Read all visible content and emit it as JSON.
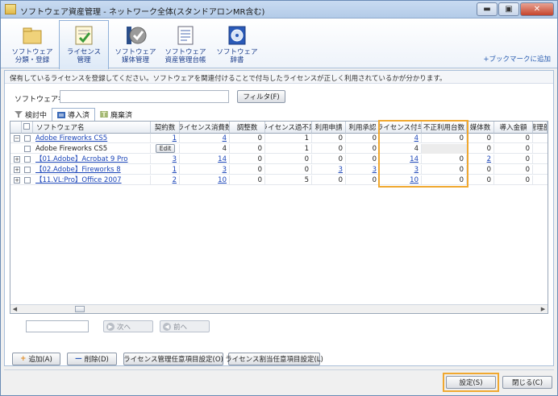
{
  "window": {
    "title": "ソフトウェア資産管理 - ネットワーク全体(スタンドアロンMR含む)",
    "min_glyph": "▬",
    "max_glyph": "▣",
    "close_glyph": "✕"
  },
  "ribbon": {
    "items": [
      {
        "label1": "ソフトウェア",
        "label2": "分類・登録",
        "icon": "folder-icon"
      },
      {
        "label1": "ライセンス",
        "label2": "管理",
        "icon": "license-check-icon"
      },
      {
        "label1": "ソフトウェア",
        "label2": "媒体管理",
        "icon": "media-disc-icon"
      },
      {
        "label1": "ソフトウェア",
        "label2": "資産管理台帳",
        "icon": "ledger-icon"
      },
      {
        "label1": "ソフトウェア",
        "label2": "辞書",
        "icon": "dictionary-cd-icon"
      }
    ],
    "bookmark": "+ブックマークに追加"
  },
  "info_text": "保有しているライセンスを登録してください。ソフトウェアを関連付けることで付与したライセンスが正しく利用されているかが分かります。",
  "filter": {
    "label": "ソフトウェア名",
    "value": "",
    "button": "フィルタ(F)"
  },
  "tabs": [
    {
      "label": "検討中",
      "icon": "funnel-icon",
      "active": false
    },
    {
      "label": "導入済",
      "icon": "list-icon",
      "active": true
    },
    {
      "label": "廃棄済",
      "icon": "trash-icon",
      "active": false
    }
  ],
  "grid": {
    "columns": [
      "ソフトウェア名",
      "契約数",
      "ライセンス消費数",
      "調整数",
      "ライセンス過不足",
      "利用申請",
      "利用承認",
      "ライセンス付与",
      "不正利用台数",
      "媒体数",
      "導入金額",
      "管理部"
    ],
    "edit_label": "Edit",
    "rows": [
      {
        "expander": "−",
        "name": "Adobe Fireworks CS5",
        "link": true,
        "cells": [
          "1",
          "4",
          "0",
          "1",
          "0",
          "0",
          "4",
          "0",
          "0",
          "0"
        ]
      },
      {
        "expander": "",
        "name": "Adobe Fireworks CS5",
        "link": false,
        "cells": [
          "",
          "4",
          "0",
          "1",
          "0",
          "0",
          "4",
          "",
          "0",
          "0"
        ]
      },
      {
        "expander": "+",
        "name": "【01.Adobe】Acrobat 9 Pro",
        "link": true,
        "cells": [
          "3",
          "14",
          "0",
          "0",
          "0",
          "0",
          "14",
          "0",
          "2",
          "0"
        ]
      },
      {
        "expander": "+",
        "name": "【02.Adobe】Fireworks 8",
        "link": true,
        "cells": [
          "1",
          "3",
          "0",
          "0",
          "3",
          "3",
          "3",
          "0",
          "0",
          "0"
        ]
      },
      {
        "expander": "+",
        "name": "【11.VL:Pro】Office 2007",
        "link": true,
        "cells": [
          "2",
          "10",
          "0",
          "5",
          "0",
          "0",
          "10",
          "0",
          "0",
          "0"
        ]
      }
    ]
  },
  "pager": {
    "next": "次へ",
    "prev": "前へ"
  },
  "actions": {
    "add": "追加(A)",
    "delete": "削除(D)",
    "license_custom": "ライセンス管理任意項目設定(O)",
    "assign_custom": "ライセンス割当任意項目設定(L)",
    "ok": "設定(S)",
    "close": "閉じる(C)"
  },
  "colors": {
    "highlight": "#f0a830",
    "link": "#1a44b8"
  }
}
